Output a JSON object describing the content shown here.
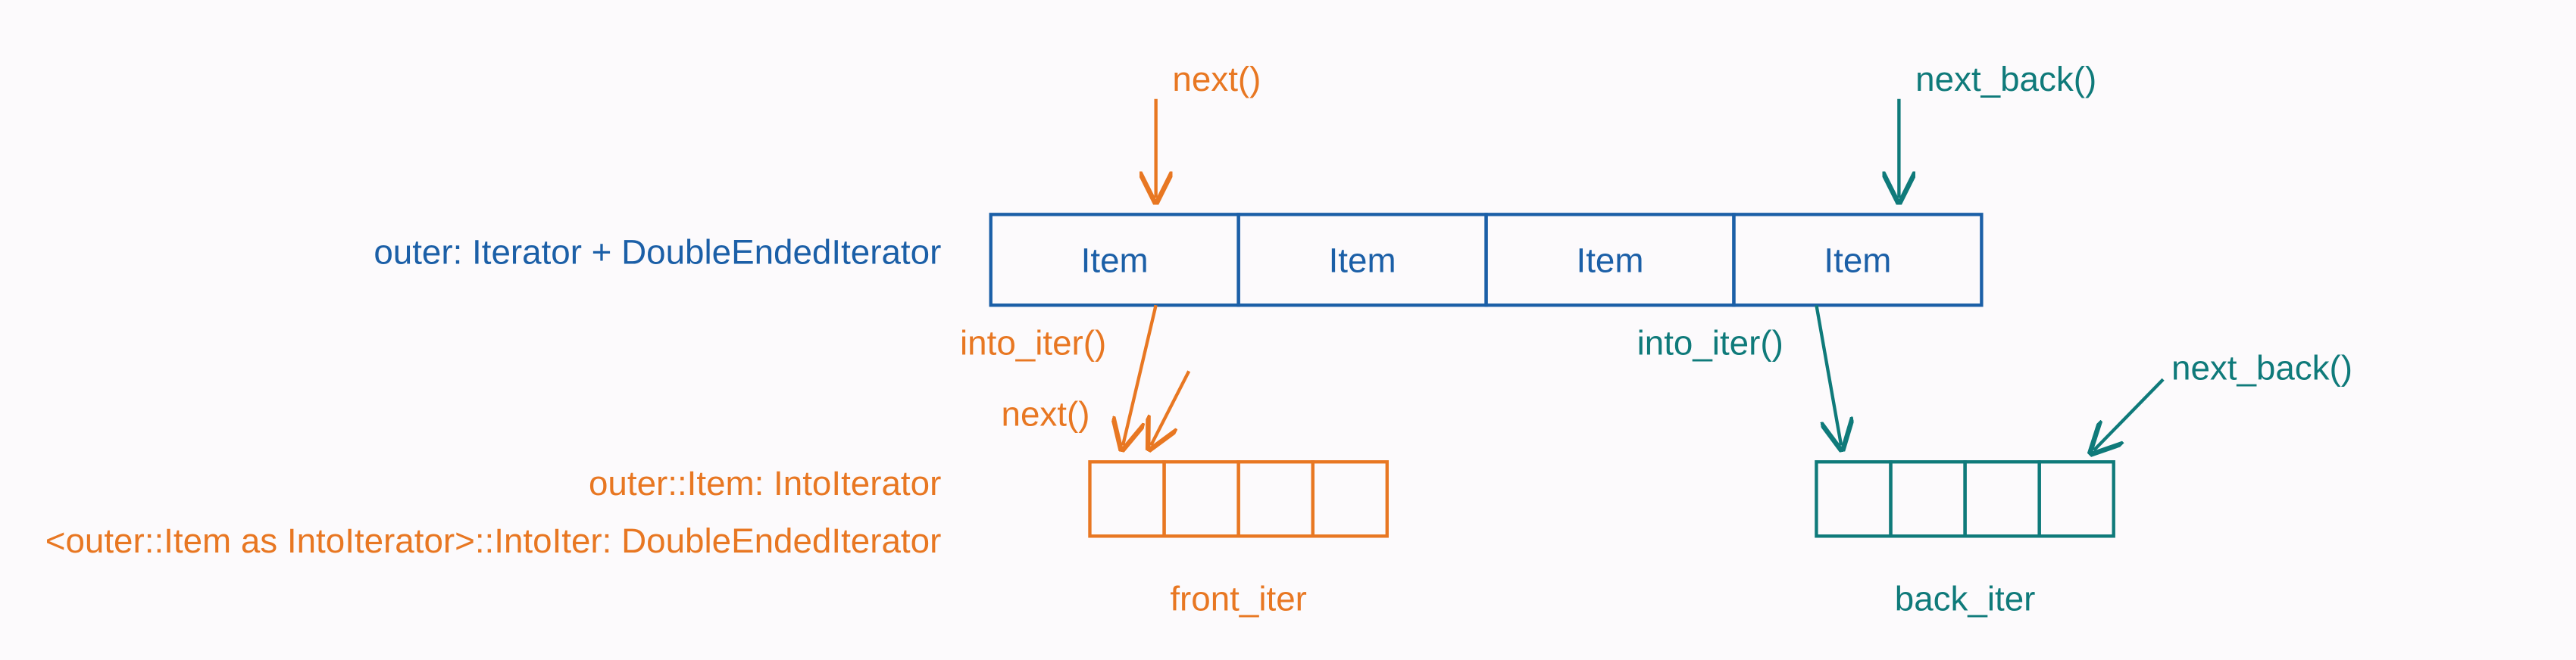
{
  "labels": {
    "outer_type": "outer: Iterator + DoubleEndedIterator",
    "item_type": "outer::Item: IntoIterator",
    "intoiter_type": "<outer::Item as IntoIterator>::IntoIter: DoubleEndedIterator",
    "next": "next()",
    "next_back": "next_back()",
    "into_iter": "into_iter()",
    "front_iter": "front_iter",
    "back_iter": "back_iter"
  },
  "outer_items": [
    "Item",
    "Item",
    "Item",
    "Item"
  ],
  "colors": {
    "blue": "#1b5fa7",
    "orange": "#e87722",
    "teal": "#0f7a7a"
  }
}
